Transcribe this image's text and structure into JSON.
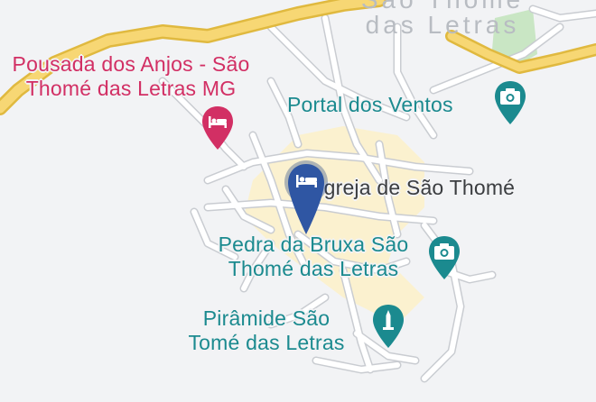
{
  "map": {
    "town_label_line1": "São Thomé",
    "town_label_line2": "das Letras",
    "colors": {
      "background": "#f2f3f5",
      "road": "#ffffff",
      "road_outline": "#c9ccd1",
      "highway": "#f7d774",
      "highway_outline": "#e0b93f",
      "urban": "#fbf1cf",
      "park": "#c9e6c4",
      "hotel_poi": "#d22f64",
      "attraction_poi": "#1b8a8f",
      "selected_pin": "#2f56a3"
    }
  },
  "places": {
    "pousada": {
      "line1": "Pousada dos Anjos - São",
      "line2": "Thomé das Letras MG",
      "icon": "bed-icon"
    },
    "portal": {
      "label": "Portal dos Ventos",
      "icon": "camera-icon"
    },
    "igreja": {
      "label": "Igreja de São Thomé"
    },
    "pedra": {
      "line1": "Pedra da Bruxa São",
      "line2": "Thomé das Letras",
      "icon": "camera-icon"
    },
    "piramide": {
      "line1": "Pirâmide São",
      "line2": "Tomé das Letras",
      "icon": "monument-icon"
    },
    "selected_marker": {
      "icon": "bed-icon"
    }
  }
}
